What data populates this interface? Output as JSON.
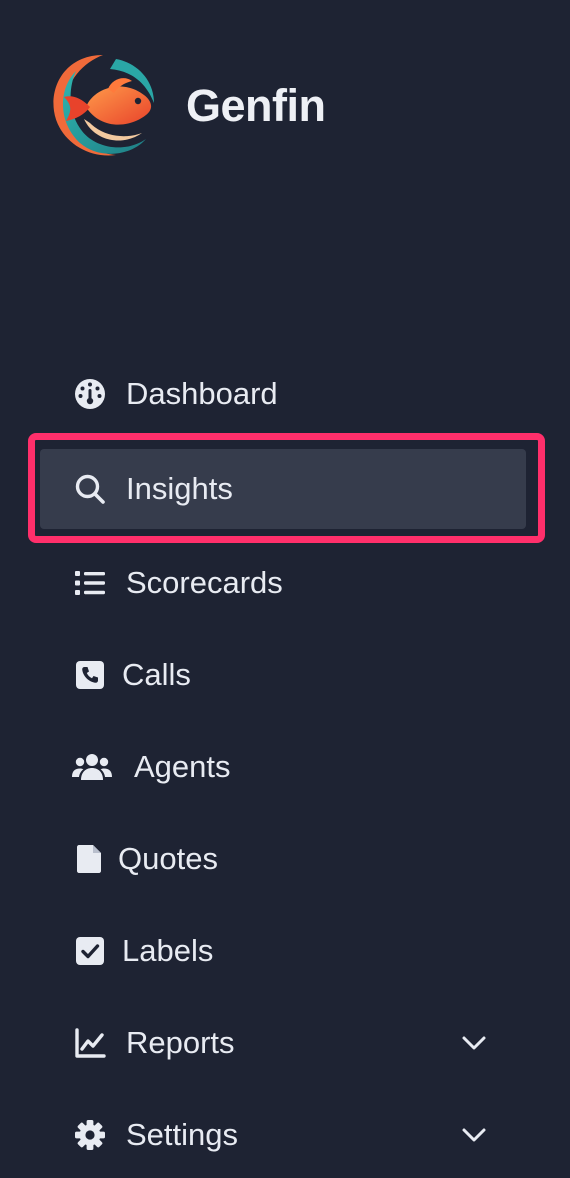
{
  "brand": {
    "name": "Genfin",
    "logo": "fish-logo"
  },
  "nav": {
    "active": "Insights",
    "items": [
      {
        "label": "Dashboard",
        "icon": "gauge-icon"
      },
      {
        "label": "Insights",
        "icon": "search-icon"
      },
      {
        "label": "Scorecards",
        "icon": "list-icon"
      },
      {
        "label": "Calls",
        "icon": "phone-icon"
      },
      {
        "label": "Agents",
        "icon": "users-icon"
      },
      {
        "label": "Quotes",
        "icon": "file-icon"
      },
      {
        "label": "Labels",
        "icon": "checkbox-icon"
      },
      {
        "label": "Reports",
        "icon": "chart-line-icon",
        "expandable": true
      },
      {
        "label": "Settings",
        "icon": "gear-icon",
        "expandable": true
      }
    ]
  },
  "colors": {
    "background": "#1e2333",
    "active_item": "#363c4c",
    "highlight_border": "#ff2f6b",
    "text": "#e8ebf2"
  }
}
